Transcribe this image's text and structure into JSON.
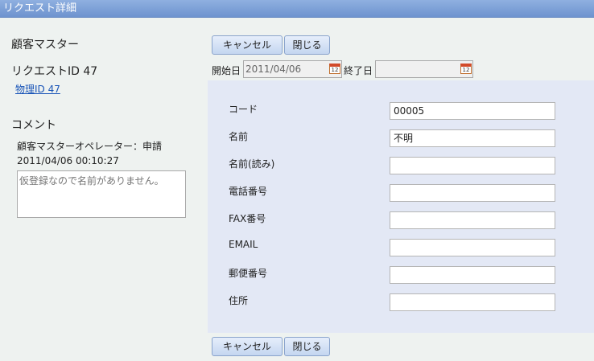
{
  "window": {
    "title": "リクエスト詳細"
  },
  "sidebar": {
    "heading": "顧客マスター",
    "request_id": "リクエストID 47",
    "physical_id_link": "物理ID 47",
    "comment_heading": "コメント",
    "comment_author": "顧客マスターオペレーター：申請",
    "comment_timestamp": "2011/04/06 00:10:27",
    "comment_text": "仮登録なので名前がありません。"
  },
  "toolbar": {
    "cancel_label": "キャンセル",
    "close_label": "閉じる"
  },
  "dates": {
    "start_label": "開始日",
    "start_value": "2011/04/06",
    "end_label": "終了日",
    "end_value": "",
    "calendar_icon_text": "12"
  },
  "form": {
    "fields": [
      {
        "label": "コード",
        "value": "00005"
      },
      {
        "label": "名前",
        "value": "不明"
      },
      {
        "label": "名前(読み)",
        "value": ""
      },
      {
        "label": "電話番号",
        "value": ""
      },
      {
        "label": "FAX番号",
        "value": ""
      },
      {
        "label": "EMAIL",
        "value": ""
      },
      {
        "label": "郵便番号",
        "value": ""
      },
      {
        "label": "住所",
        "value": ""
      }
    ]
  }
}
